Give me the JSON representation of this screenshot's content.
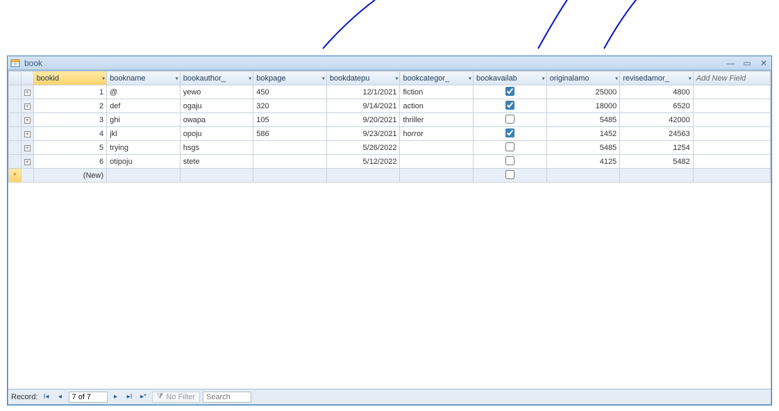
{
  "window": {
    "title": "book"
  },
  "columns": {
    "bookid": "bookid",
    "bookname": "bookname",
    "bookauthor": "bookauthor_",
    "bokpage": "bokpage",
    "bookdatepu": "bookdatepu",
    "bookcategor": "bookcategor_",
    "bookavailab": "bookavailab",
    "originalamo": "originalamo",
    "revisedamor": "revisedamor_",
    "addnew": "Add New Field"
  },
  "rows": [
    {
      "bookid": "1",
      "bookname": "@",
      "bookauthor": "yewo",
      "bokpage": "450",
      "bookdatepu": "12/1/2021",
      "bookcategor": "fiction",
      "bookavailab": true,
      "originalamo": "25000",
      "revisedamor": "4800"
    },
    {
      "bookid": "2",
      "bookname": "def",
      "bookauthor": "ogaju",
      "bokpage": "320",
      "bookdatepu": "9/14/2021",
      "bookcategor": "action",
      "bookavailab": true,
      "originalamo": "18000",
      "revisedamor": "6520"
    },
    {
      "bookid": "3",
      "bookname": "ghi",
      "bookauthor": "owapa",
      "bokpage": "105",
      "bookdatepu": "9/20/2021",
      "bookcategor": "thriller",
      "bookavailab": false,
      "originalamo": "5485",
      "revisedamor": "42000"
    },
    {
      "bookid": "4",
      "bookname": "jkl",
      "bookauthor": "opoju",
      "bokpage": "586",
      "bookdatepu": "9/23/2021",
      "bookcategor": "horror",
      "bookavailab": true,
      "originalamo": "1452",
      "revisedamor": "24563"
    },
    {
      "bookid": "5",
      "bookname": "trying",
      "bookauthor": "hsgs",
      "bokpage": "",
      "bookdatepu": "5/26/2022",
      "bookcategor": "",
      "bookavailab": false,
      "originalamo": "5485",
      "revisedamor": "1254"
    },
    {
      "bookid": "6",
      "bookname": "otipoju",
      "bookauthor": "stete",
      "bokpage": "",
      "bookdatepu": "5/12/2022",
      "bookcategor": "",
      "bookavailab": false,
      "originalamo": "4125",
      "revisedamor": "5482"
    }
  ],
  "newrow": {
    "label": "(New)"
  },
  "nav": {
    "record_label": "Record:",
    "position": "7 of 7",
    "nofilter": "No Filter",
    "search_placeholder": "Search"
  }
}
